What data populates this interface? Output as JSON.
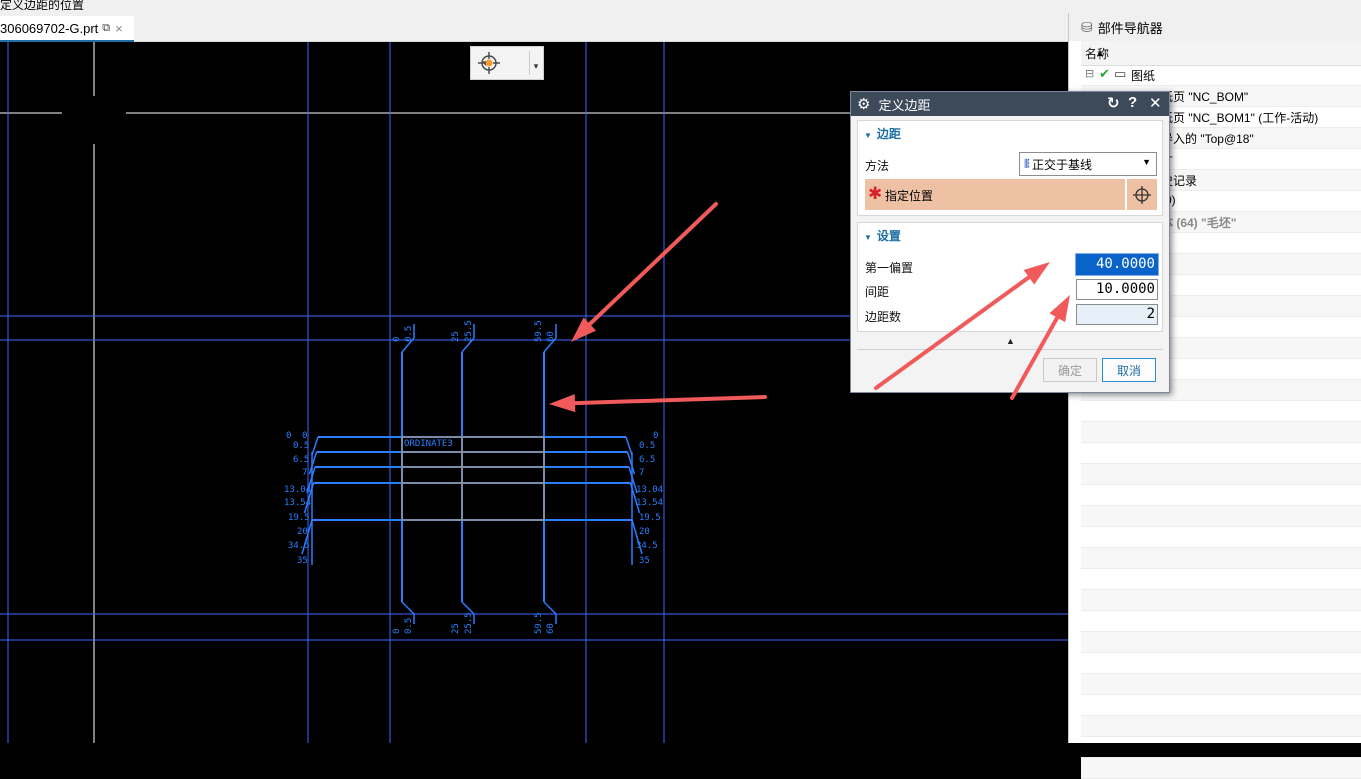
{
  "window": {
    "status_text": "定义边距的位置",
    "file_tab": {
      "name": "306069702-G.prt",
      "close": "×"
    }
  },
  "snap_toolbar": {
    "icon": "crosshair-snap-icon",
    "arrow": "▾",
    "more": "▾"
  },
  "part_navigator": {
    "title": "部件导航器",
    "column_name": "名称",
    "sort_arrow": "▲",
    "rows": [
      {
        "text": "图纸",
        "indent": 0
      },
      {
        "text": "图纸页 \"NC_BOM\"",
        "indent": 1
      },
      {
        "text": "图纸页 \"NC_BOM1\" (工作-活动)",
        "indent": 1
      },
      {
        "text": "导入的 \"Top@18\"",
        "indent": 2
      },
      {
        "text": "寸",
        "indent": 2
      },
      {
        "text": "史记录",
        "indent": 2
      },
      {
        "text": "(0)",
        "indent": 2
      },
      {
        "text": "体 (64) \"毛坯\"",
        "indent": 2
      }
    ]
  },
  "dialog": {
    "title": "定义边距",
    "reset": "↻",
    "help": "?",
    "close": "✕",
    "group_margin": {
      "title": "边距",
      "method_label": "方法",
      "method_value": "正交于基线",
      "specify_position": "指定位置"
    },
    "group_settings": {
      "title": "设置",
      "first_offset_label": "第一偏置",
      "first_offset_value": "40.0000",
      "spacing_label": "间距",
      "spacing_value": "10.0000",
      "count_label": "边距数",
      "count_value": "2"
    },
    "ok": "确定",
    "cancel": "取消"
  },
  "drawing": {
    "top_labels": [
      "0",
      "0.5",
      "25",
      "25.5",
      "59.5",
      "60"
    ],
    "bottom_labels": [
      "0",
      "0.5",
      "25",
      "25.5",
      "59.5",
      "60"
    ],
    "left_labels": [
      "0",
      "0",
      "0.5",
      "6.5",
      "7",
      "13.04",
      "13.54",
      "19.5",
      "20",
      "34.5",
      "35"
    ],
    "right_labels": [
      "0",
      "0.5",
      "6.5",
      "7",
      "13.04",
      "13.54",
      "19.5",
      "20",
      "34.5",
      "35"
    ],
    "table_label": "ORDINATE3",
    "colors": {
      "geometry": "#2a7fff",
      "frame": "#3b68ff",
      "table": "#c79a5a",
      "annotation": "#f15a5a",
      "cursor": "#ffffff"
    }
  }
}
